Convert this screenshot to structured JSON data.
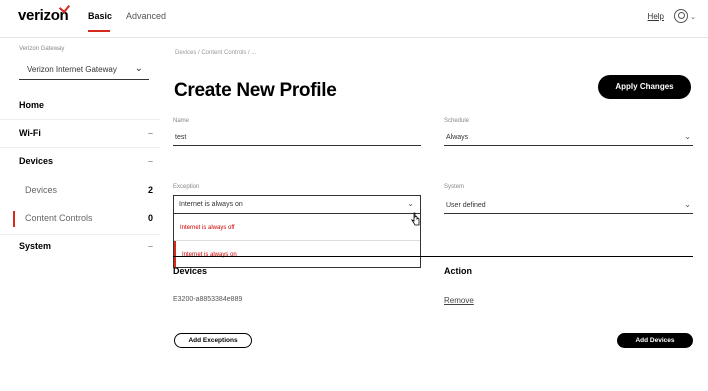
{
  "header": {
    "logo": "verizon",
    "tabs": [
      "Basic",
      "Advanced"
    ],
    "help_link": "Help"
  },
  "sidebar": {
    "gateway_label": "Verizon Gateway",
    "gateway_value": "Verizon Internet Gateway",
    "items": [
      {
        "label": "Home"
      },
      {
        "label": "Wi-Fi"
      },
      {
        "label": "Devices"
      },
      {
        "label": "Devices",
        "count": "2"
      },
      {
        "label": "Content Controls",
        "count": "0"
      },
      {
        "label": "System"
      }
    ]
  },
  "main": {
    "breadcrumb": "Devices / Content Controls / ...",
    "title": "Create New Profile",
    "apply_button": "Apply Changes",
    "name_label": "Name",
    "name_value": "test",
    "schedule_label": "Schedule",
    "schedule_value": "Always",
    "exception_label": "Exception",
    "exception_value": "Internet is always on",
    "exception_options": [
      "Internet is always off",
      "Internet is always on"
    ],
    "system_label": "System",
    "system_value": "User defined",
    "table_headers": [
      "Devices",
      "Action"
    ],
    "device_name": "E3200-a8853384e889",
    "remove_link": "Remove",
    "add_exceptions_button": "Add Exceptions",
    "add_devices_button": "Add Devices"
  },
  "colors": {
    "accent": "#d52b1e",
    "primary_button": "#000000"
  }
}
